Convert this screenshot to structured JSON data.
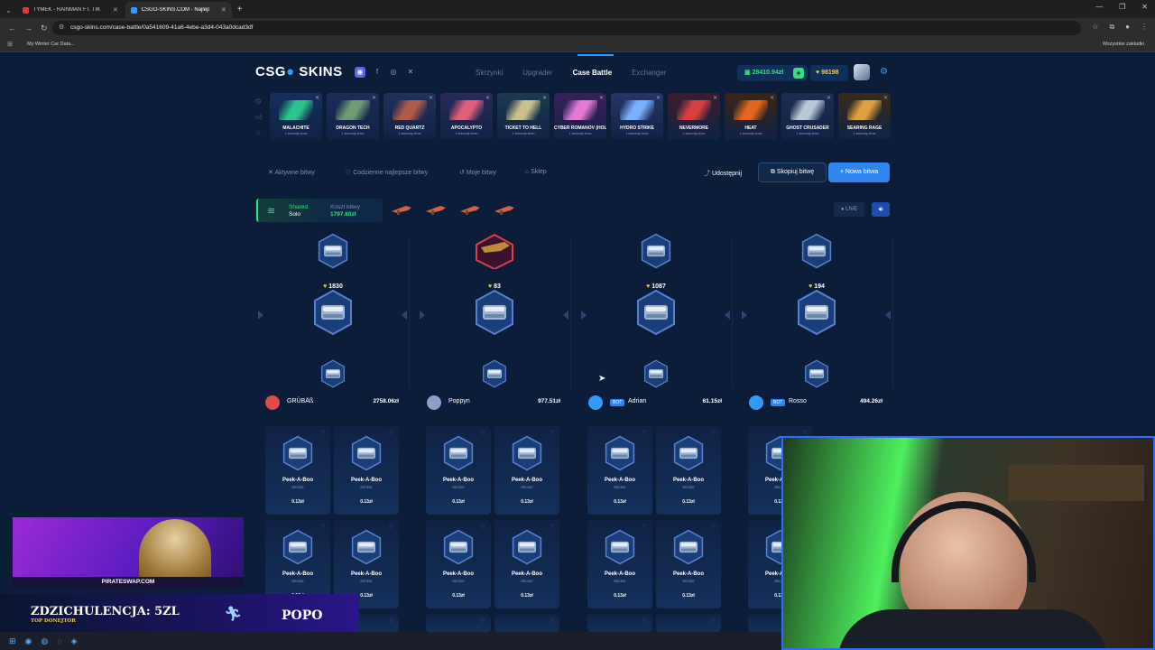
{
  "browser": {
    "tabs": [
      {
        "title": "TYMEK - RAINMAN FT. TIK",
        "fav": "#e03b3b"
      },
      {
        "title": "CSGO-SKINS.COM - Najlep",
        "fav": "#2f9bff"
      }
    ],
    "url": "csgo-skins.com/case-battle/0a541609-41a6-4ebe-a3d4-043a0dcad3df",
    "bookmark": "My Winter Car Data...",
    "bookmarks_right": "Wszystkie zakładki"
  },
  "header": {
    "brand_a": "CSG",
    "brand_b": "SKINS",
    "nav": [
      "Skrzynki",
      "Upgrader",
      "Case Battle",
      "Exchanger"
    ],
    "balance": "28410.94zł",
    "coins": "98198"
  },
  "drops": [
    {
      "name": "MALACHITE",
      "sub": "1 sekundę temu",
      "bg": "#14305c",
      "img": "#2bc48a"
    },
    {
      "name": "DRAGON TECH",
      "sub": "1 sekundę temu",
      "bg": "#1c2d57",
      "img": "#6f9b73"
    },
    {
      "name": "RED QUARTZ",
      "sub": "1 sekundę temu",
      "bg": "#22305a",
      "img": "#b05a4a"
    },
    {
      "name": "APOCALYPTO",
      "sub": "1 sekundę temu",
      "bg": "#2a2a5a",
      "img": "#e0607a"
    },
    {
      "name": "TICKET TO HELL",
      "sub": "1 sekundę temu",
      "bg": "#1d3a4f",
      "img": "#c9c08a"
    },
    {
      "name": "CYBER ROMANOV (HOLO)",
      "sub": "1 sekundę temu",
      "bg": "#3a1f5a",
      "img": "#e27ad6"
    },
    {
      "name": "HYDRO STRIKE",
      "sub": "1 sekundę temu",
      "bg": "#243766",
      "img": "#7ab0ff"
    },
    {
      "name": "NEVERMORE",
      "sub": "1 sekundę temu",
      "bg": "#3a1d2c",
      "img": "#d84040"
    },
    {
      "name": "HEAT",
      "sub": "1 sekundę temu",
      "bg": "#3a2418",
      "img": "#e3661f"
    },
    {
      "name": "GHOST CRUSADER",
      "sub": "1 sekundę temu",
      "bg": "#1e2c52",
      "img": "#b9c9d9"
    },
    {
      "name": "SEARING RAGE",
      "sub": "1 sekundę temu",
      "bg": "#3a2a18",
      "img": "#e0a040"
    }
  ],
  "subnav": {
    "items": [
      "Aktywne bitwy",
      "Codzienne najlepsze bitwy",
      "Moje bitwy",
      "Sklep"
    ],
    "share": "Udostępnij",
    "copy": "Skopiuj bitwę",
    "new": "Nowa bitwa"
  },
  "battle": {
    "mode_a": "Shared",
    "mode_b": "Solo",
    "cost_label": "Koszt bitwy",
    "cost": "1797.60zł",
    "live": "LIVE",
    "scores": [
      "1830",
      "83",
      "1087",
      "194"
    ]
  },
  "players": [
    {
      "name": "GRÜBÄß",
      "value": "2758.06zł",
      "bot": false,
      "av": "#e04a4a"
    },
    {
      "name": "Poppyn",
      "value": "977.51zł",
      "bot": false,
      "av": "#8aa0c8"
    },
    {
      "name": "Adrian",
      "value": "61.15zł",
      "bot": true,
      "av": "#2f9bff"
    },
    {
      "name": "Rosso",
      "value": "494.26zł",
      "bot": true,
      "av": "#2f9bff"
    }
  ],
  "item": {
    "name": "Peek-A-Boo",
    "type": "Sticker",
    "price": "0.13zł"
  },
  "overlay": {
    "ad_url": "PIRATESWAP.COM",
    "donor": "ZDZICHULENCJA: 5ZL",
    "donor_tag": "TOP DONEJTOR",
    "right_name": "POPO"
  }
}
